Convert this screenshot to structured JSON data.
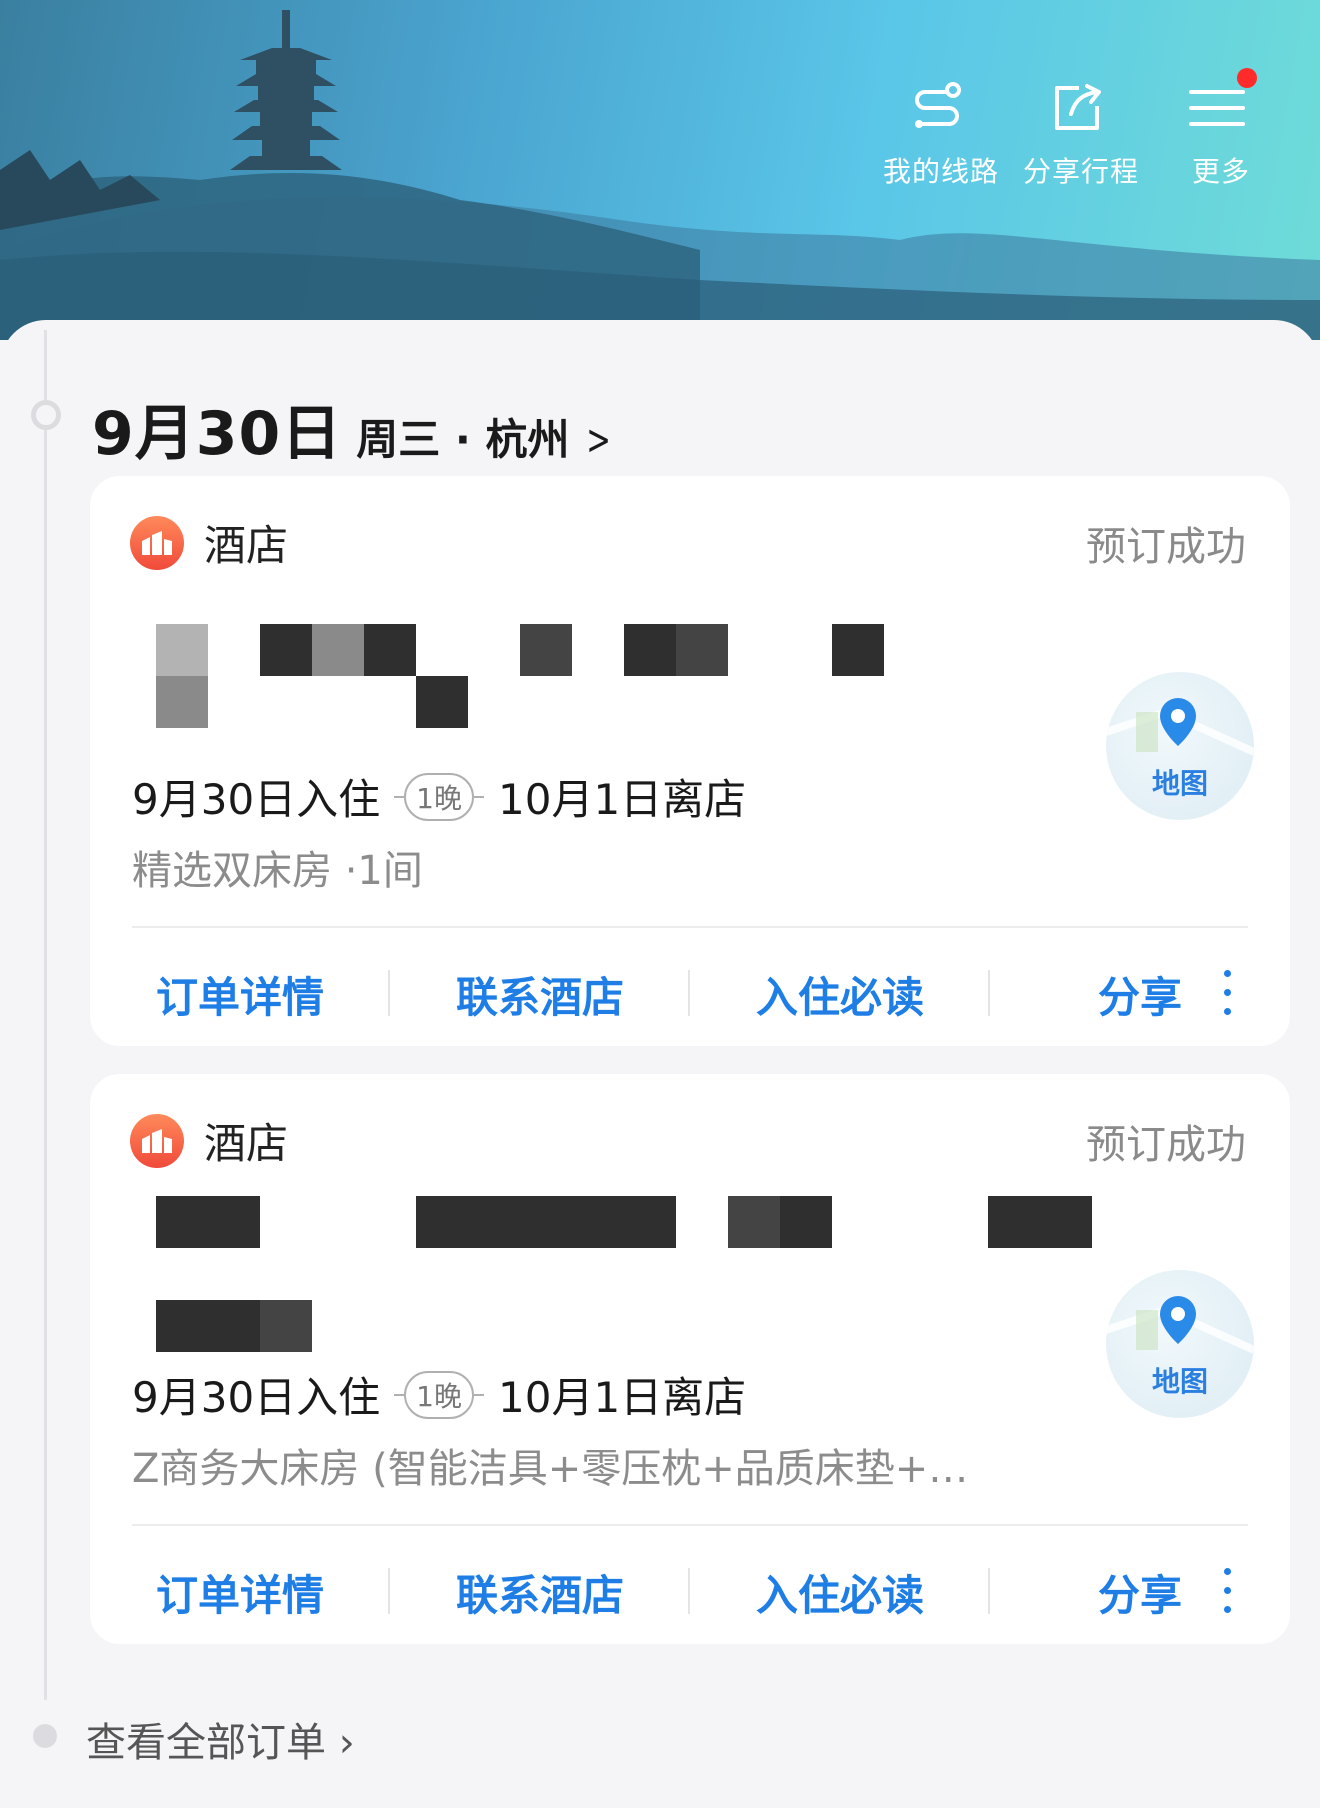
{
  "header": {
    "actions": [
      {
        "label": "我的线路",
        "icon": "route-icon"
      },
      {
        "label": "分享行程",
        "icon": "share-out-icon"
      },
      {
        "label": "更多",
        "icon": "menu-icon",
        "badge": "red-dot"
      }
    ]
  },
  "day": {
    "date": "9月30日",
    "sub": "周三 · 杭州",
    "chevron": ">"
  },
  "cards": [
    {
      "type": "酒店",
      "status": "预订成功",
      "checkin": "9月30日入住",
      "nights": "1晚",
      "checkout": "10月1日离店",
      "room": "精选双床房 ·1间",
      "map_label": "地图",
      "actions": [
        "订单详情",
        "联系酒店",
        "入住必读",
        "分享"
      ]
    },
    {
      "type": "酒店",
      "status": "预订成功",
      "checkin": "9月30日入住",
      "nights": "1晚",
      "checkout": "10月1日离店",
      "room": "Z商务大床房 (智能洁具+零压枕+品质床垫+…",
      "map_label": "地图",
      "actions": [
        "订单详情",
        "联系酒店",
        "入住必读",
        "分享"
      ]
    }
  ],
  "footer": {
    "view_all": "查看全部订单 ›"
  },
  "colors": {
    "accent": "#1e7ee6",
    "status_gray": "#8a8a8a",
    "hotel_icon": "#f04a3a",
    "badge": "#ff2a2a"
  }
}
